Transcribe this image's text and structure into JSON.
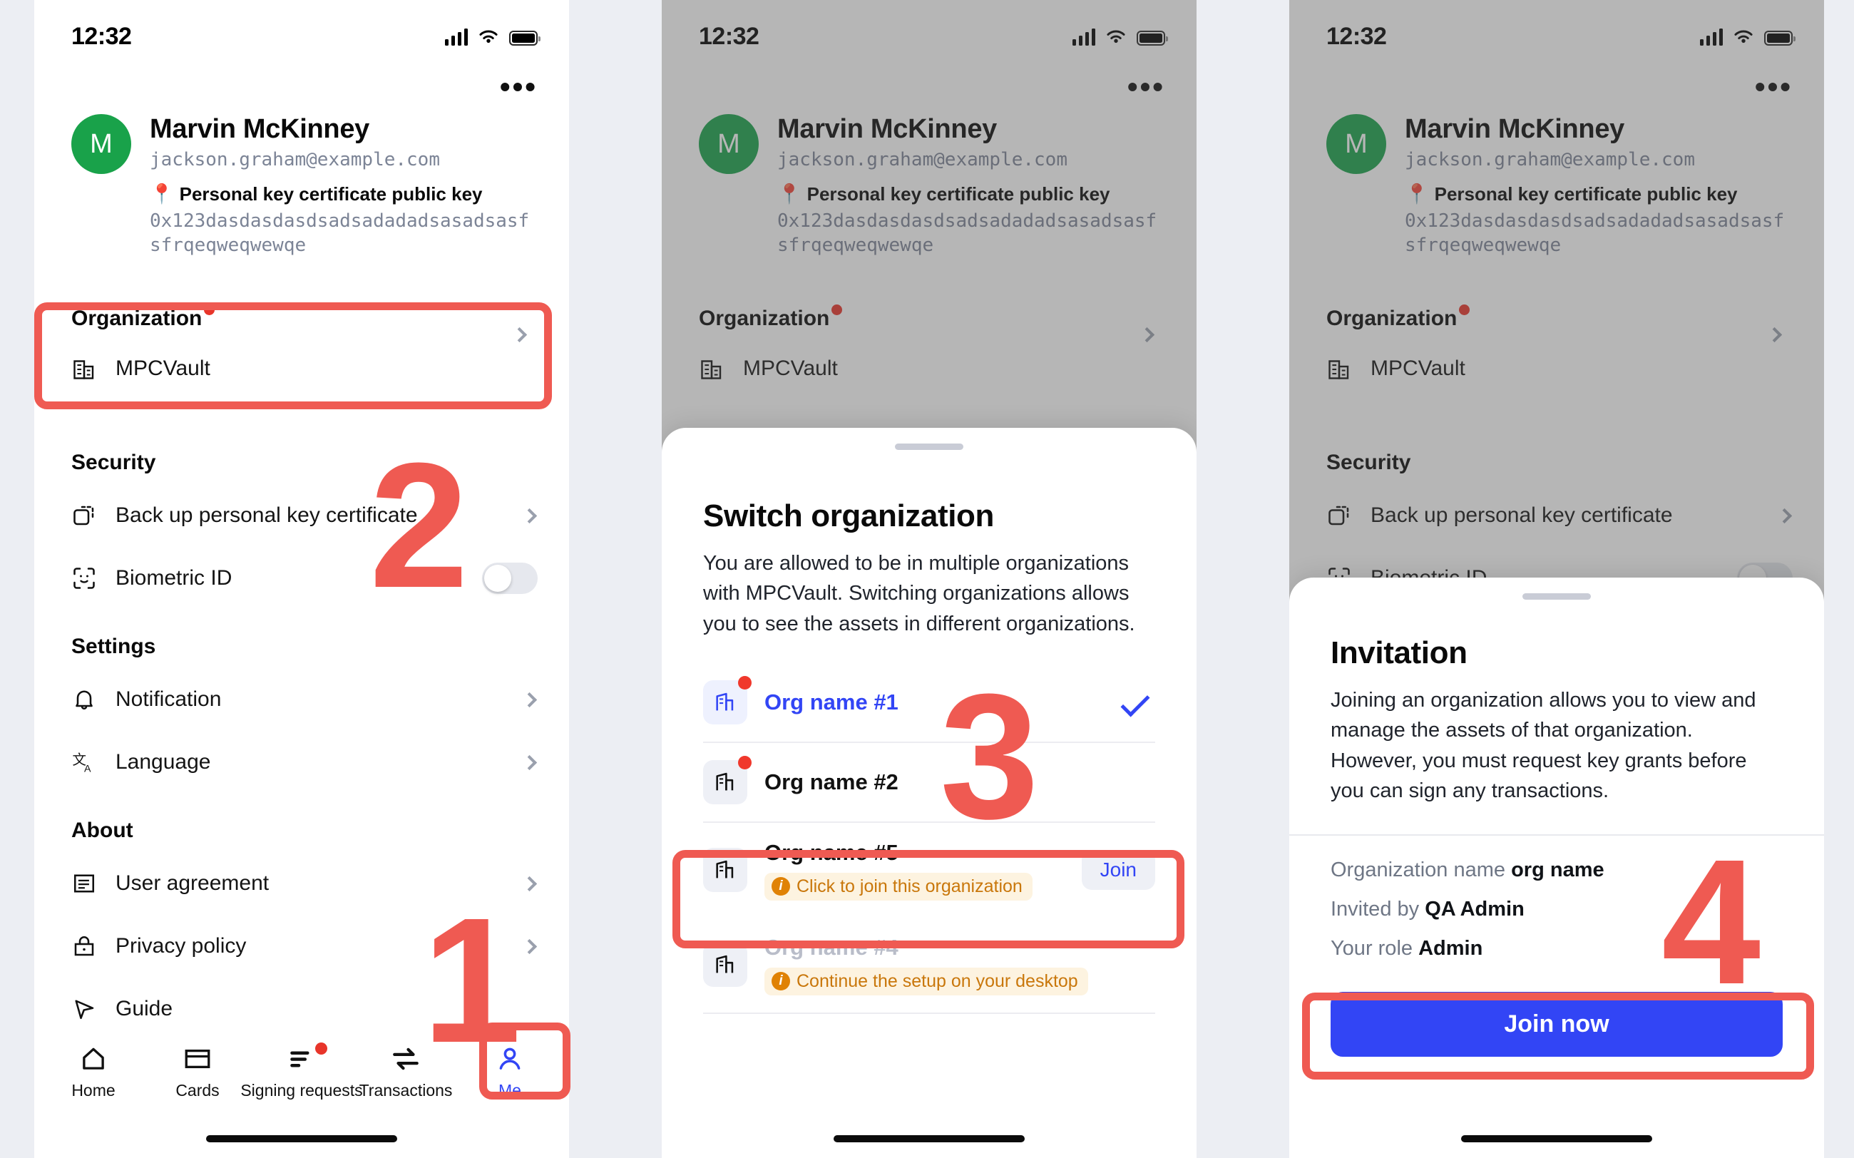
{
  "status_bar": {
    "time": "12:32"
  },
  "profile": {
    "avatar_initial": "M",
    "name": "Marvin McKinney",
    "email": "jackson.graham@example.com",
    "key_label": "Personal key certificate public key",
    "key_value": "0x123dasdasdasdsadsadadadsasadsasfsfrqeqweqwewqe"
  },
  "sections": {
    "organization": {
      "title": "Organization",
      "current_org": "MPCVault"
    },
    "security": {
      "title": "Security",
      "items": [
        {
          "label": "Back up personal key certificate",
          "control": "chevron"
        },
        {
          "label": "Biometric ID",
          "control": "toggle",
          "toggle_on": false
        }
      ]
    },
    "settings": {
      "title": "Settings",
      "items": [
        {
          "label": "Notification"
        },
        {
          "label": "Language"
        }
      ]
    },
    "about": {
      "title": "About",
      "items": [
        {
          "label": "User agreement"
        },
        {
          "label": "Privacy policy"
        },
        {
          "label": "Guide"
        }
      ]
    }
  },
  "tabbar": {
    "items": [
      {
        "label": "Home",
        "icon": "home-icon",
        "active": false,
        "badge": false
      },
      {
        "label": "Cards",
        "icon": "cards-icon",
        "active": false,
        "badge": false
      },
      {
        "label": "Signing requests",
        "icon": "signing-requests-icon",
        "active": false,
        "badge": true
      },
      {
        "label": "Transactions",
        "icon": "transactions-icon",
        "active": false,
        "badge": false
      },
      {
        "label": "Me",
        "icon": "person-icon",
        "active": true,
        "badge": false
      }
    ]
  },
  "switch_sheet": {
    "title": "Switch organization",
    "body": "You are allowed to be in multiple organizations with MPCVault. Switching organizations allows you to see the assets in different organizations.",
    "orgs": [
      {
        "name": "Org name #1",
        "state": "selected",
        "red_dot": true,
        "trailing": "check"
      },
      {
        "name": "Org name #2",
        "state": "normal",
        "red_dot": true,
        "trailing": "none"
      },
      {
        "name": "Org name #5",
        "state": "joinable",
        "red_dot": false,
        "trailing": "join",
        "join_label": "Join",
        "pill": "Click to join this organization"
      },
      {
        "name": "Org name #4",
        "state": "disabled",
        "red_dot": false,
        "trailing": "none",
        "pill": "Continue the setup on your desktop"
      }
    ]
  },
  "invitation_sheet": {
    "title": "Invitation",
    "body": "Joining an organization allows you to view and manage the assets of that organization. However, you must request key grants before you can sign any transactions.",
    "fields": [
      {
        "label": "Organization name",
        "value": "org name"
      },
      {
        "label": "Invited by",
        "value": "QA Admin"
      },
      {
        "label": "Your role",
        "value": "Admin"
      }
    ],
    "cta_label": "Join now"
  },
  "annotations": {
    "steps": [
      "1",
      "2",
      "3",
      "4"
    ],
    "accent_color": "#ef5a52",
    "brand_color": "#3245f5"
  }
}
